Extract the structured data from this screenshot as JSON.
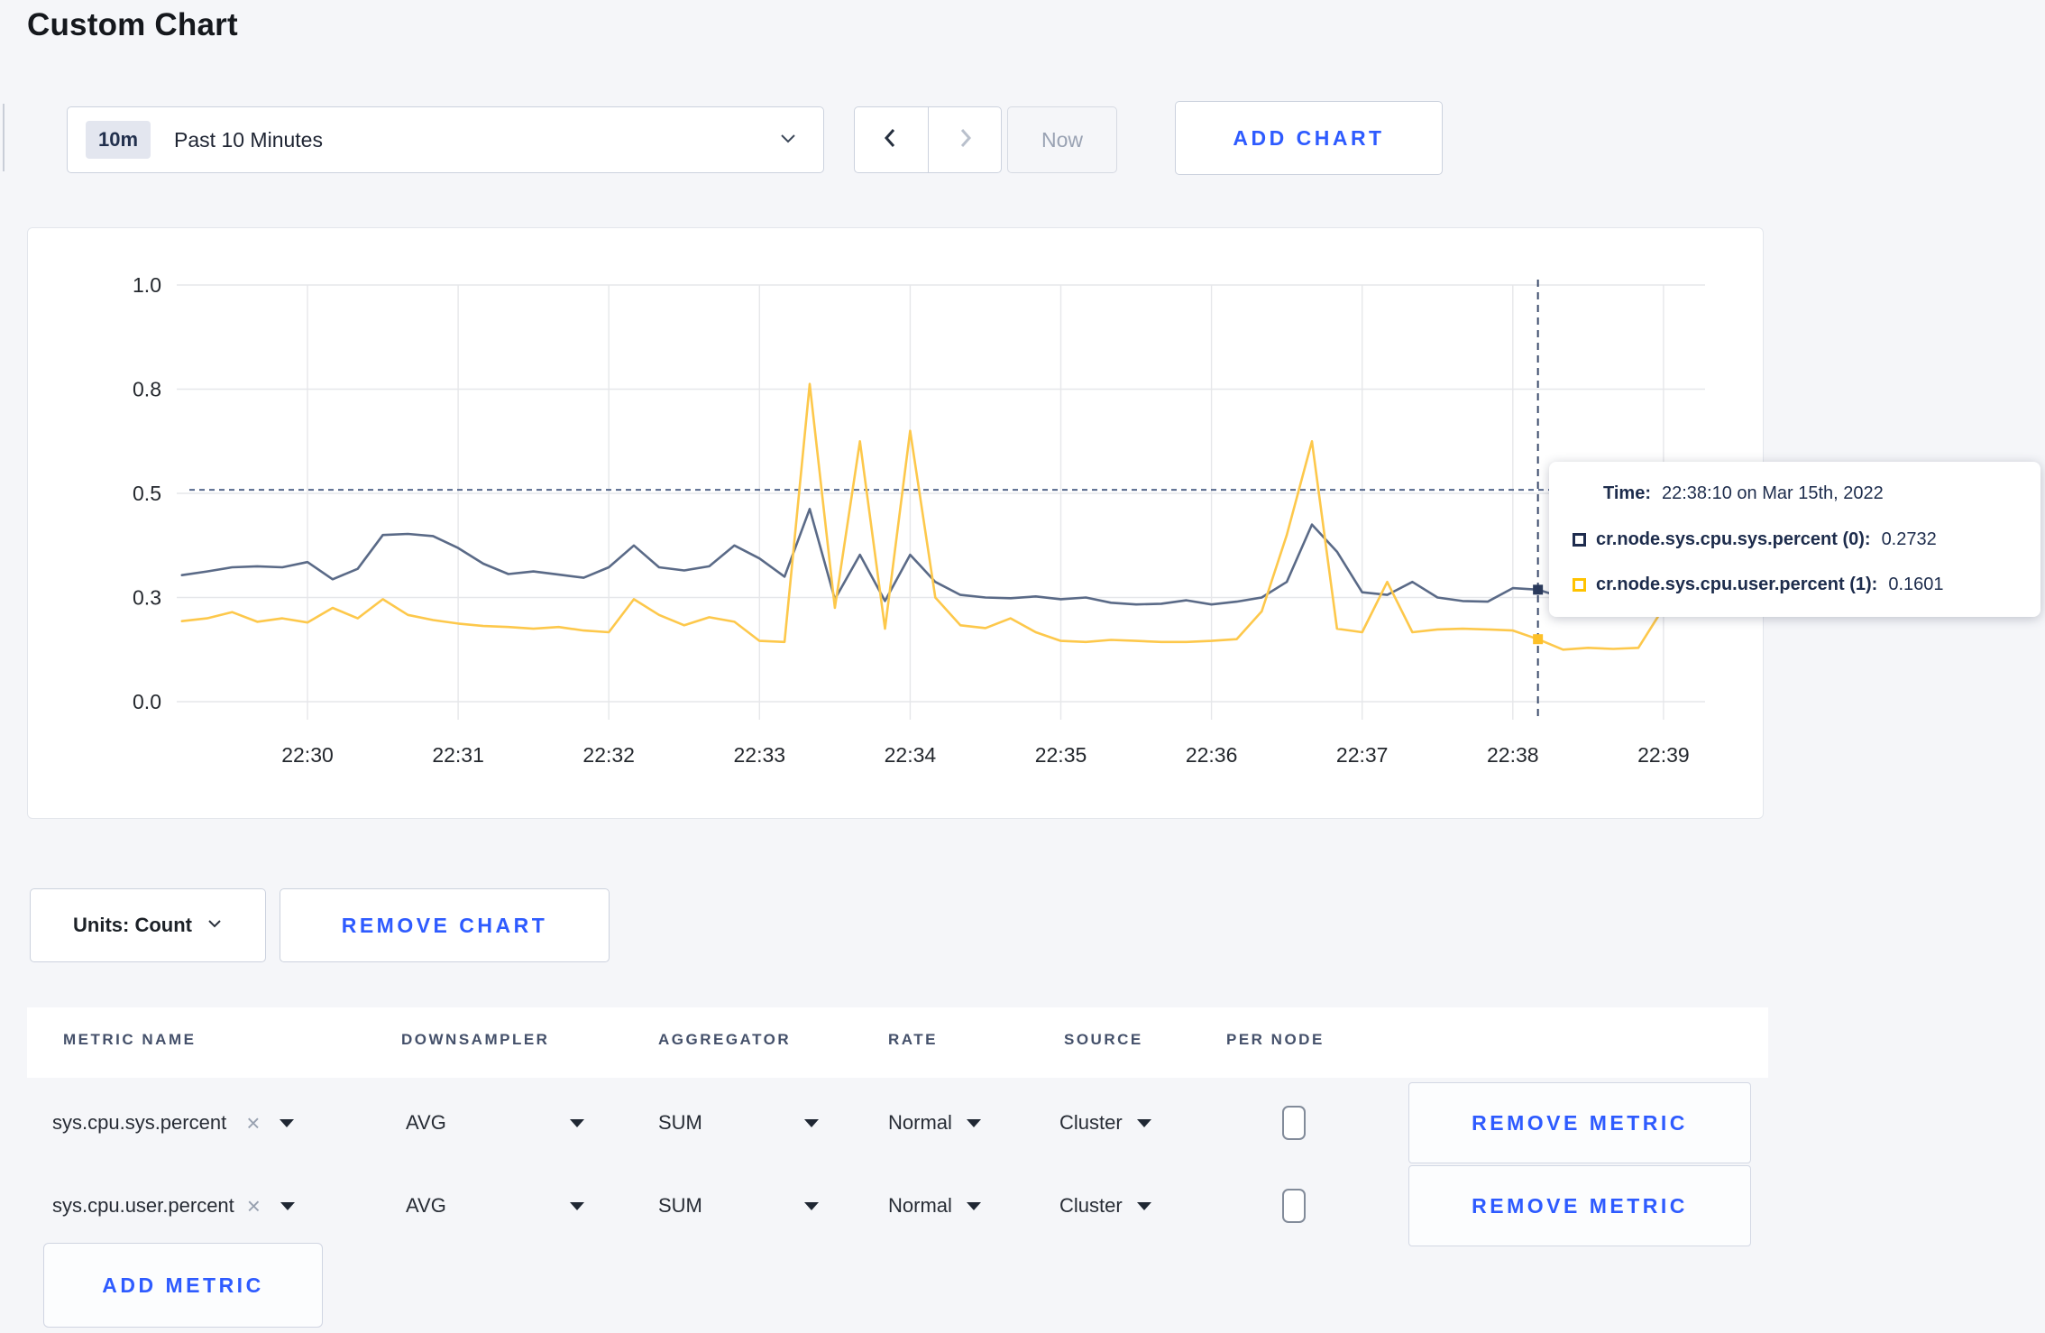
{
  "page": {
    "title": "Custom Chart"
  },
  "toolbar": {
    "time_range": {
      "badge": "10m",
      "label": "Past 10 Minutes"
    },
    "now_label": "Now",
    "add_chart_label": "ADD CHART"
  },
  "chart_controls": {
    "units_label": "Units: Count",
    "remove_chart_label": "REMOVE CHART"
  },
  "tooltip": {
    "time_label": "Time:",
    "time_value": "22:38:10 on Mar 15th, 2022",
    "rows": [
      {
        "label": "cr.node.sys.cpu.sys.percent (0):",
        "value": "0.2732",
        "color": "#1e2c4e"
      },
      {
        "label": "cr.node.sys.cpu.user.percent (1):",
        "value": "0.1601",
        "color": "#ffc300"
      }
    ]
  },
  "chart_data": {
    "type": "line",
    "title": "",
    "xlabel": "",
    "ylabel": "",
    "grid": true,
    "legend_position": "tooltip",
    "y_ticks": [
      0.0,
      0.3,
      0.5,
      0.8,
      1.0
    ],
    "y_tick_labels": [
      "0.0",
      "0.3",
      "0.5",
      "0.8",
      "1.0"
    ],
    "x_ticks": [
      "22:30",
      "22:31",
      "22:32",
      "22:33",
      "22:34",
      "22:35",
      "22:36",
      "22:37",
      "22:38",
      "22:39"
    ],
    "start_offset_seconds": -50,
    "interval_seconds": 10,
    "reference_line_value": 0.51,
    "hover": {
      "index": 54,
      "time": "22:38:10",
      "values": [
        0.2732,
        0.1601
      ]
    },
    "series": [
      {
        "name": "cr.node.sys.cpu.sys.percent",
        "color": "#5a6a87",
        "dot_color": "#2a3a5c",
        "values": [
          0.343,
          0.35,
          0.358,
          0.36,
          0.358,
          0.368,
          0.335,
          0.355,
          0.42,
          0.422,
          0.418,
          0.395,
          0.365,
          0.345,
          0.35,
          0.344,
          0.338,
          0.358,
          0.4,
          0.358,
          0.352,
          0.36,
          0.4,
          0.375,
          0.34,
          0.47,
          0.295,
          0.382,
          0.29,
          0.382,
          0.33,
          0.305,
          0.3,
          0.298,
          0.302,
          0.295,
          0.3,
          0.285,
          0.28,
          0.282,
          0.292,
          0.28,
          0.288,
          0.3,
          0.33,
          0.44,
          0.388,
          0.31,
          0.305,
          0.33,
          0.3,
          0.29,
          0.288,
          0.318,
          0.315,
          0.3,
          0.295,
          0.33,
          0.3,
          0.285,
          0.29
        ]
      },
      {
        "name": "cr.node.sys.cpu.user.percent",
        "color": "#fdc84b",
        "dot_color": "#fdc028",
        "values": [
          0.232,
          0.24,
          0.258,
          0.23,
          0.24,
          0.228,
          0.27,
          0.24,
          0.295,
          0.25,
          0.235,
          0.225,
          0.218,
          0.215,
          0.21,
          0.215,
          0.205,
          0.2,
          0.295,
          0.25,
          0.22,
          0.243,
          0.23,
          0.175,
          0.172,
          0.81,
          0.27,
          0.65,
          0.21,
          0.68,
          0.3,
          0.22,
          0.212,
          0.24,
          0.2,
          0.175,
          0.172,
          0.178,
          0.175,
          0.172,
          0.172,
          0.175,
          0.18,
          0.26,
          0.42,
          0.65,
          0.21,
          0.2,
          0.33,
          0.2,
          0.208,
          0.21,
          0.208,
          0.205,
          0.18,
          0.15,
          0.155,
          0.152,
          0.155,
          0.27,
          0.255
        ]
      }
    ]
  },
  "metrics_table": {
    "headers": [
      "METRIC NAME",
      "DOWNSAMPLER",
      "AGGREGATOR",
      "RATE",
      "SOURCE",
      "PER NODE"
    ],
    "remove_metric_label": "REMOVE METRIC",
    "add_metric_label": "ADD METRIC",
    "rows": [
      {
        "metric": "sys.cpu.sys.percent",
        "downsampler": "AVG",
        "aggregator": "SUM",
        "rate": "Normal",
        "source": "Cluster",
        "per_node_checked": false
      },
      {
        "metric": "sys.cpu.user.percent",
        "downsampler": "AVG",
        "aggregator": "SUM",
        "rate": "Normal",
        "source": "Cluster",
        "per_node_checked": false
      }
    ]
  }
}
